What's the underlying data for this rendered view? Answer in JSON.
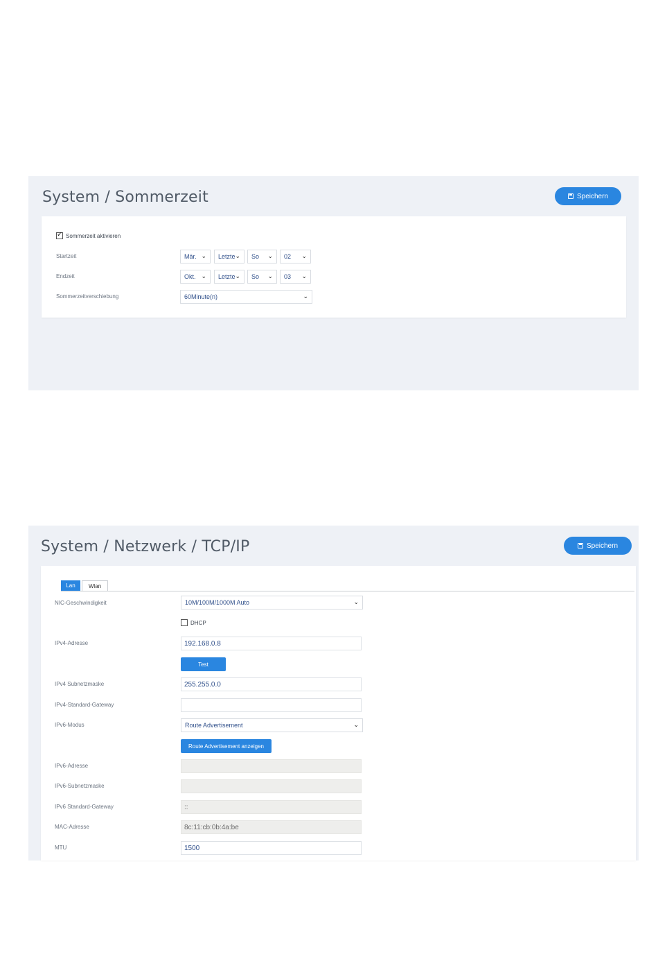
{
  "sommerzeit": {
    "title": "System / Sommerzeit",
    "save_label": "Speichern",
    "enable_label": "Sommerzeit aktivieren",
    "enable_checked": true,
    "start_label": "Startzeit",
    "start": {
      "month": "Mär.",
      "week": "Letzte",
      "day": "So",
      "hour": "02"
    },
    "end_label": "Endzeit",
    "end": {
      "month": "Okt.",
      "week": "Letzte",
      "day": "So",
      "hour": "03"
    },
    "shift_label": "Sommerzeitverschiebung",
    "shift_value": "60Minute(n)"
  },
  "network": {
    "title": "System / Netzwerk / TCP/IP",
    "save_label": "Speichern",
    "tabs": [
      {
        "label": "Lan",
        "active": true
      },
      {
        "label": "Wlan",
        "active": false
      }
    ],
    "nic_label": "NIC-Geschwindigkeit",
    "nic_value": "10M/100M/1000M Auto",
    "dhcp_label": "DHCP",
    "dhcp_checked": false,
    "ipv4_label": "IPv4-Adresse",
    "ipv4_value": "192.168.0.8",
    "test_label": "Test",
    "subnet_label": "IPv4 Subnetzmaske",
    "subnet_value": "255.255.0.0",
    "gateway_label": "IPv4-Standard-Gateway",
    "gateway_value": "",
    "ipv6_mode_label": "IPv6-Modus",
    "ipv6_mode_value": "Route Advertisement",
    "route_adv_button": "Route Advertisement anzeigen",
    "ipv6_addr_label": "IPv6-Adresse",
    "ipv6_addr_value": "",
    "ipv6_subnet_label": "IPv6-Subnetzmaske",
    "ipv6_subnet_value": "",
    "ipv6_gateway_label": "IPv6 Standard-Gateway",
    "ipv6_gateway_value": "::",
    "mac_label": "MAC-Adresse",
    "mac_value": "8c:11:cb:0b:4a:be",
    "mtu_label": "MTU",
    "mtu_value": "1500"
  }
}
